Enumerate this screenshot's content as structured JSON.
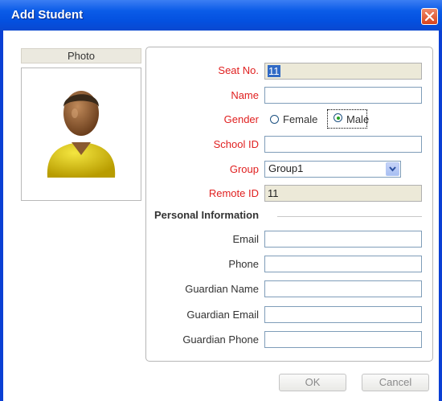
{
  "window": {
    "title": "Add Student"
  },
  "photo": {
    "label": "Photo"
  },
  "form": {
    "seat_no": {
      "label": "Seat No.",
      "value": "11"
    },
    "name": {
      "label": "Name",
      "value": ""
    },
    "gender": {
      "label": "Gender",
      "options": [
        "Female",
        "Male"
      ],
      "selected": "Male"
    },
    "school_id": {
      "label": "School ID",
      "value": ""
    },
    "group": {
      "label": "Group",
      "value": "Group1"
    },
    "remote_id": {
      "label": "Remote ID",
      "value": "11"
    }
  },
  "personal": {
    "heading": "Personal Information",
    "email": {
      "label": "Email",
      "value": ""
    },
    "phone": {
      "label": "Phone",
      "value": ""
    },
    "guardian_name": {
      "label": "Guardian Name",
      "value": ""
    },
    "guardian_email": {
      "label": "Guardian Email",
      "value": ""
    },
    "guardian_phone": {
      "label": "Guardian Phone",
      "value": ""
    }
  },
  "buttons": {
    "ok": "OK",
    "cancel": "Cancel"
  },
  "colors": {
    "titlebar": "#0b5ce8",
    "required_label": "#e02020",
    "close_button": "#d8431c"
  },
  "icons": {
    "close": "close-icon",
    "avatar": "person-avatar-icon",
    "dropdown": "chevron-down-icon"
  }
}
